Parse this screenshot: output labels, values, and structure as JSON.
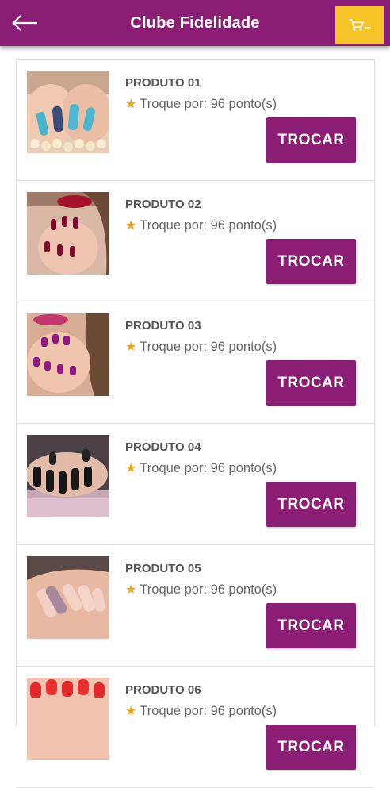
{
  "header": {
    "title": "Clube Fidelidade",
    "back_icon": "arrow-left-icon",
    "cart_icon": "cart-icon",
    "bar_color": "#8b1e74",
    "cart_color": "#f5c426"
  },
  "products": [
    {
      "name": "PRODUTO 01",
      "points_text": "Troque por: 96 ponto(s)",
      "button": "TROCAR"
    },
    {
      "name": "PRODUTO 02",
      "points_text": "Troque por: 96 ponto(s)",
      "button": "TROCAR"
    },
    {
      "name": "PRODUTO 03",
      "points_text": "Troque por: 96 ponto(s)",
      "button": "TROCAR"
    },
    {
      "name": "PRODUTO 04",
      "points_text": "Troque por: 96 ponto(s)",
      "button": "TROCAR"
    },
    {
      "name": "PRODUTO 05",
      "points_text": "Troque por: 96 ponto(s)",
      "button": "TROCAR"
    },
    {
      "name": "PRODUTO 06",
      "points_text": "Troque por: 96 ponto(s)",
      "button": "TROCAR"
    }
  ]
}
